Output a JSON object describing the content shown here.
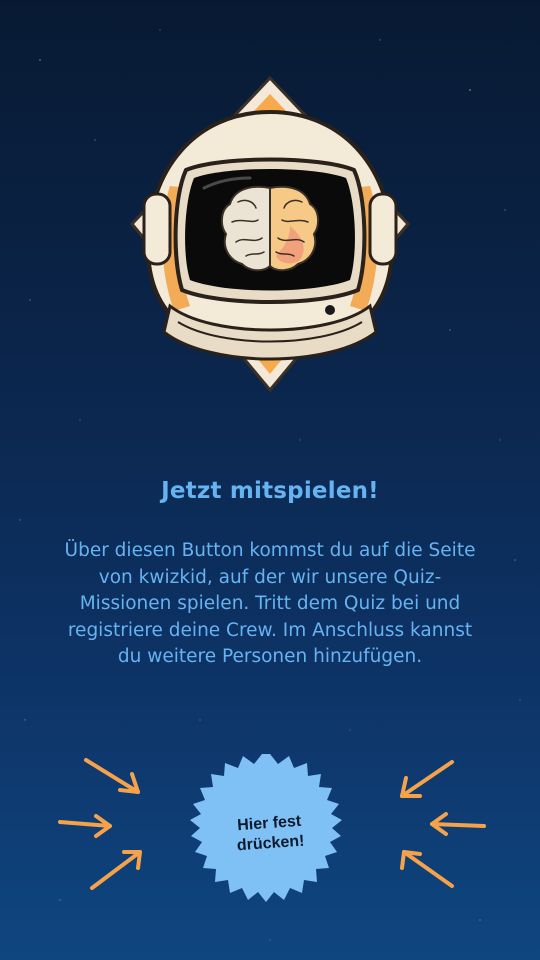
{
  "heading": "Jetzt mitspielen!",
  "description": "Über diesen Button kommst du auf die Seite von kwizkid, auf der wir unsere Quiz- Missionen spielen. Tritt dem Quiz bei und registriere deine Crew. Im Anschluss kannst du weitere Personen hinzufügen.",
  "cta": {
    "label": "Hier fest\ndrücken!"
  },
  "colors": {
    "accent_text": "#66b3f2",
    "badge": "#7fc0f5",
    "arrow": "#f5a24a",
    "diamond": "#f7a94b"
  },
  "icons": [
    "astronaut-helmet-logo",
    "brain-icon",
    "arrow-icon"
  ]
}
